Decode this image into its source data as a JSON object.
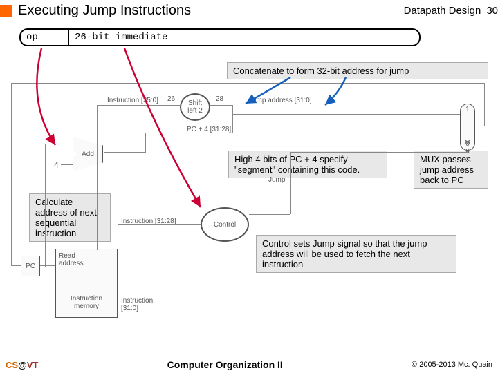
{
  "header": {
    "title": "Executing Jump Instructions",
    "section": "Datapath Design",
    "page": "30"
  },
  "instruction": {
    "op": "op",
    "immediate": "26-bit immediate"
  },
  "callouts": {
    "concat": "Concatenate to form 32-bit address for jump",
    "high4": "High 4 bits of PC + 4 specify \"segment\" containing this code.",
    "mux": "MUX passes jump address back to PC",
    "calc": "Calculate address of next sequential instruction",
    "control": "Control sets Jump signal so that the jump address will be used to fetch the next instruction"
  },
  "diagram": {
    "pc": "PC",
    "readaddr": "Read\naddress",
    "imem": "Instruction\nmemory",
    "instr": "Instruction\n[31:0]",
    "four": "4",
    "add": "Add",
    "shift": "Shift\nleft 2",
    "control": "Control",
    "mux": "M\nu\nx",
    "mux1": "1",
    "mux0": "0",
    "bus_instr26": "Instruction [25:0]",
    "bus_jump": "Jump address [31:0]",
    "bus_pc4": "PC + 4 [31:28]",
    "bus_instr28": "Instruction [31:28]",
    "sig_jump": "Jump",
    "w26": "26",
    "w28": "28"
  },
  "footer": {
    "left_cs": "CS",
    "left_at": "@",
    "left_vt": "VT",
    "center": "Computer Organization II",
    "right": "© 2005-2013 Mc. Quain"
  }
}
